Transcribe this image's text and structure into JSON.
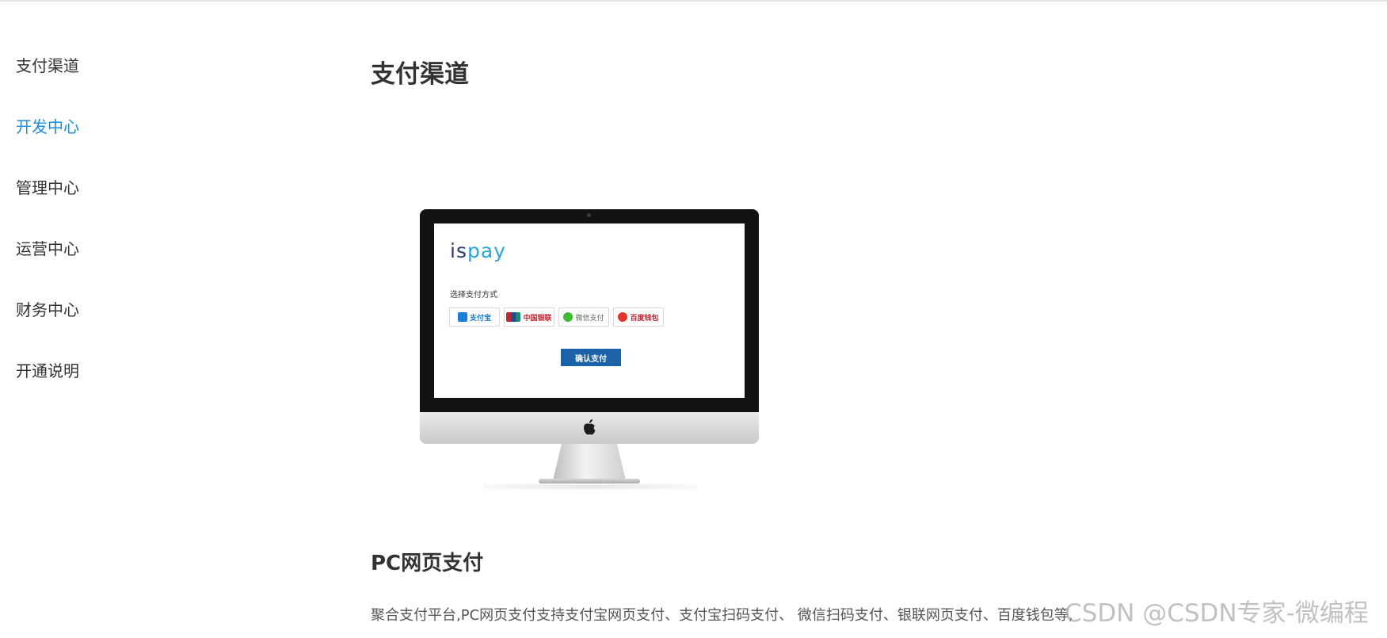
{
  "sidebar": {
    "items": [
      {
        "label": "支付渠道",
        "active": false
      },
      {
        "label": "开发中心",
        "active": true
      },
      {
        "label": "管理中心",
        "active": false
      },
      {
        "label": "运营中心",
        "active": false
      },
      {
        "label": "财务中心",
        "active": false
      },
      {
        "label": "开通说明",
        "active": false
      }
    ]
  },
  "main": {
    "title": "支付渠道",
    "illustration": {
      "logo_is": "is",
      "logo_pay": "pay",
      "choose_label": "选择支付方式",
      "methods": [
        {
          "label": "支付宝",
          "icon": "alipay-icon"
        },
        {
          "label": "中国银联",
          "icon": "unionpay-icon"
        },
        {
          "label": "微信支付",
          "icon": "wechat-pay-icon"
        },
        {
          "label": "百度钱包",
          "icon": "baidu-wallet-icon"
        }
      ],
      "confirm_label": "确认支付"
    },
    "section_title": "PC网页支付",
    "section_desc": "聚合支付平台,PC网页支付支持支付宝网页支付、支付宝扫码支付、 微信扫码支付、银联网页支付、百度钱包等,"
  },
  "watermark": "CSDN @CSDN专家-微编程",
  "colors": {
    "accent": "#1a8ee0",
    "confirm_button": "#1b63a8",
    "logo_is": "#2a3b7c",
    "logo_pay": "#26a6dc"
  }
}
